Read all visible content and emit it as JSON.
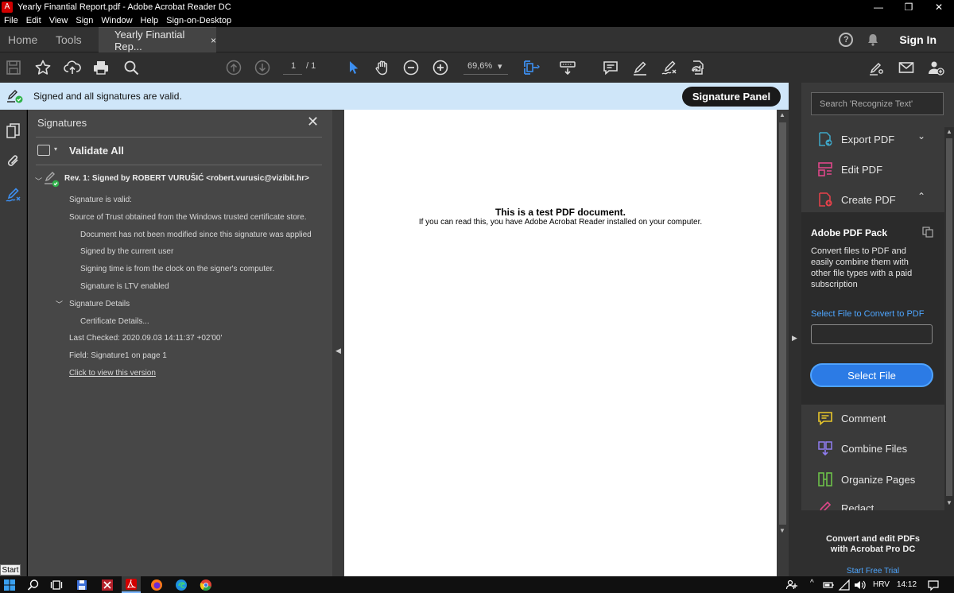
{
  "window": {
    "title": "Yearly Finantial Report.pdf - Adobe Acrobat Reader DC",
    "controls": {
      "minimize": "—",
      "maximize": "❐",
      "close": "✕"
    }
  },
  "menu": [
    "File",
    "Edit",
    "View",
    "Sign",
    "Window",
    "Help",
    "Sign-on-Desktop"
  ],
  "tabs": {
    "home": "Home",
    "tools": "Tools",
    "document": "Yearly Finantial Rep...",
    "close": "×",
    "help_glyph": "?",
    "sign_in": "Sign In"
  },
  "toolbar": {
    "page_current": "1",
    "page_total": "/ 1",
    "zoom": "69,6%",
    "zoom_caret": "▾"
  },
  "notice": {
    "text": "Signed and all signatures are valid.",
    "button": "Signature Panel"
  },
  "signatures": {
    "title": "Signatures",
    "close": "✕",
    "validate_all": "Validate All",
    "caret": "▾",
    "rev_caret": "﹀",
    "details_caret": "﹀",
    "rev": "Rev. 1: Signed by ROBERT VURUŠIĆ <robert.vurusic@vizibit.hr>",
    "lines": {
      "valid": "Signature is valid:",
      "trust": "Source of Trust obtained from the Windows trusted certificate store.",
      "not_modified": "Document has not been modified since this signature was applied",
      "current_user": "Signed by the current user",
      "signing_time": "Signing time is from the clock on the signer's computer.",
      "ltv": "Signature is LTV enabled",
      "details": "Signature Details",
      "cert": "Certificate Details...",
      "last_checked": "Last Checked: 2020.09.03 14:11:37 +02'00'",
      "field": "Field: Signature1 on page 1",
      "view_version": "Click to view this version"
    }
  },
  "document": {
    "heading": "This is a test PDF document.",
    "body": "If you can read this, you have Adobe Acrobat Reader installed on your computer."
  },
  "rightpane": {
    "search_placeholder": "Search 'Recognize Text'",
    "tools": {
      "export": "Export PDF",
      "edit": "Edit PDF",
      "create": "Create PDF",
      "comment": "Comment",
      "combine": "Combine Files",
      "organize": "Organize Pages",
      "redact": "Redact"
    },
    "export_chevron": "⌄",
    "create_chevron": "⌃",
    "pack": {
      "title": "Adobe PDF Pack",
      "desc": "Convert files to PDF and easily combine them with other file types with a paid subscription",
      "select_label": "Select File to Convert to PDF",
      "button": "Select File"
    },
    "promo": {
      "line1": "Convert and edit PDFs",
      "line2": "with Acrobat Pro DC",
      "link": "Start Free Trial"
    }
  },
  "taskbar": {
    "start_tooltip": "Start",
    "lang": "HRV",
    "time": "14:12",
    "caret": "^"
  },
  "colors": {
    "accent_blue": "#2c7be5",
    "notice_bg": "#cfe6f9",
    "valid_green": "#2fb34a"
  }
}
